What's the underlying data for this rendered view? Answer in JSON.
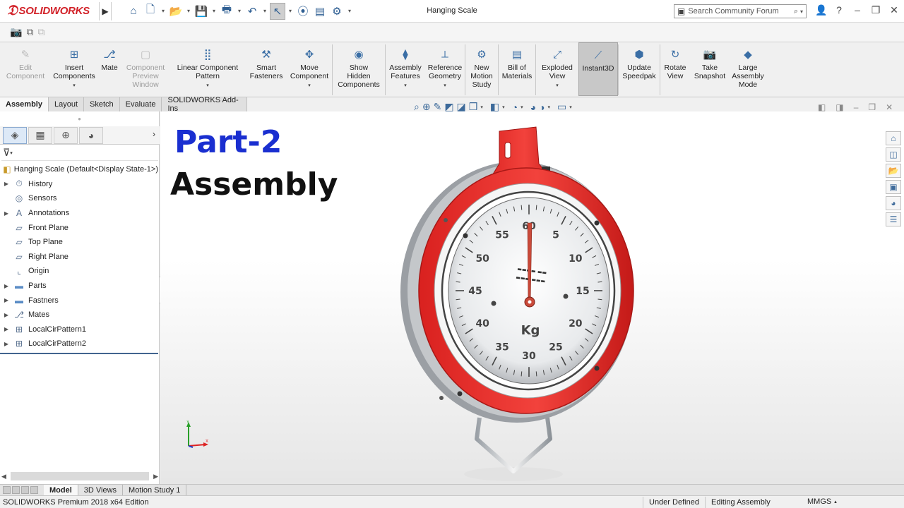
{
  "app": {
    "brand": "SOLIDWORKS",
    "window_title": "Hanging Scale",
    "search_placeholder": "Search Community Forum"
  },
  "command_manager": [
    {
      "id": "edit-component",
      "label": "Edit\nComponent",
      "disabled": true,
      "icon": "edit-component-icon"
    },
    {
      "id": "insert-components",
      "label": "Insert\nComponents",
      "disabled": false,
      "dropdown": true,
      "icon": "insert-components-icon"
    },
    {
      "id": "mate",
      "label": "Mate",
      "disabled": false,
      "icon": "paperclip-icon"
    },
    {
      "id": "component-preview-window",
      "label": "Component\nPreview\nWindow",
      "disabled": true,
      "icon": "preview-window-icon"
    },
    {
      "id": "linear-component-pattern",
      "label": "Linear Component\nPattern",
      "disabled": false,
      "dropdown": true,
      "icon": "linear-pattern-icon"
    },
    {
      "id": "smart-fasteners",
      "label": "Smart\nFasteners",
      "disabled": false,
      "icon": "smart-fasteners-icon"
    },
    {
      "id": "move-component",
      "label": "Move\nComponent",
      "disabled": false,
      "dropdown": true,
      "icon": "move-component-icon"
    },
    {
      "id": "show-hidden-components",
      "label": "Show\nHidden\nComponents",
      "disabled": false,
      "icon": "show-hidden-icon"
    },
    {
      "id": "assembly-features",
      "label": "Assembly\nFeatures",
      "disabled": false,
      "dropdown": true,
      "icon": "assembly-features-icon"
    },
    {
      "id": "reference-geometry",
      "label": "Reference\nGeometry",
      "disabled": false,
      "dropdown": true,
      "icon": "reference-geometry-icon"
    },
    {
      "id": "new-motion-study",
      "label": "New\nMotion\nStudy",
      "disabled": false,
      "icon": "motion-study-icon"
    },
    {
      "id": "bill-of-materials",
      "label": "Bill of\nMaterials",
      "disabled": false,
      "icon": "bom-icon"
    },
    {
      "id": "exploded-view",
      "label": "Exploded\nView",
      "disabled": false,
      "dropdown": true,
      "icon": "exploded-view-icon"
    },
    {
      "id": "instant3d",
      "label": "Instant3D",
      "disabled": false,
      "active": true,
      "icon": "instant3d-icon"
    },
    {
      "id": "update-speedpak",
      "label": "Update\nSpeedpak",
      "disabled": false,
      "icon": "speedpak-icon"
    },
    {
      "id": "rotate-view",
      "label": "Rotate\nView",
      "disabled": false,
      "icon": "rotate-view-icon"
    },
    {
      "id": "take-snapshot",
      "label": "Take\nSnapshot",
      "disabled": false,
      "icon": "camera-icon"
    },
    {
      "id": "large-assembly-mode",
      "label": "Large\nAssembly\nMode",
      "disabled": false,
      "icon": "large-assembly-icon"
    }
  ],
  "cm_tabs": [
    "Assembly",
    "Layout",
    "Sketch",
    "Evaluate",
    "SOLIDWORKS Add-Ins"
  ],
  "tree": {
    "root": "Hanging Scale  (Default<Display State-1>)",
    "items": [
      {
        "label": "History",
        "expandable": true,
        "icon": "history-icon"
      },
      {
        "label": "Sensors",
        "expandable": false,
        "icon": "sensors-icon"
      },
      {
        "label": "Annotations",
        "expandable": true,
        "icon": "annotations-icon"
      },
      {
        "label": "Front Plane",
        "expandable": false,
        "icon": "plane-icon"
      },
      {
        "label": "Top Plane",
        "expandable": false,
        "icon": "plane-icon"
      },
      {
        "label": "Right Plane",
        "expandable": false,
        "icon": "plane-icon"
      },
      {
        "label": "Origin",
        "expandable": false,
        "icon": "origin-icon"
      },
      {
        "label": "Parts",
        "expandable": true,
        "icon": "folder-icon"
      },
      {
        "label": "Fastners",
        "expandable": true,
        "icon": "folder-icon"
      },
      {
        "label": "Mates",
        "expandable": true,
        "icon": "mates-icon"
      },
      {
        "label": "LocalCirPattern1",
        "expandable": true,
        "icon": "circular-pattern-icon"
      },
      {
        "label": "LocalCirPattern2",
        "expandable": true,
        "icon": "circular-pattern-icon"
      }
    ]
  },
  "overlay": {
    "title": "Part-2",
    "subtitle": "Assembly"
  },
  "dial": {
    "numbers": [
      "5",
      "10",
      "15",
      "20",
      "25",
      "30",
      "35",
      "40",
      "45",
      "50",
      "55",
      "60"
    ],
    "unit": "Kg"
  },
  "bottom_tabs": [
    "Model",
    "3D Views",
    "Motion Study 1"
  ],
  "status": {
    "edition": "SOLIDWORKS Premium 2018 x64 Edition",
    "state": "Under Defined",
    "mode": "Editing Assembly",
    "units": "MMGS"
  },
  "colors": {
    "brand_red": "#d22128",
    "scale_red": "#e8302e",
    "title_blue": "#1a2fd0"
  }
}
